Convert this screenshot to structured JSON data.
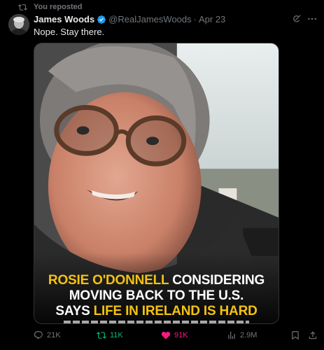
{
  "repost_banner": {
    "text": "You reposted",
    "icon": "repost-icon"
  },
  "author": {
    "display_name": "James Woods",
    "handle": "@RealJamesWoods",
    "separator": "·",
    "date": "Apr 23",
    "verified_icon": "verified-badge-icon",
    "avatar_icon": "avatar"
  },
  "header_actions": {
    "grok_icon": "grok-icon",
    "more_icon": "more-icon"
  },
  "tweet": {
    "text": "Nope. Stay there."
  },
  "media": {
    "headline_line1_highlight": "ROSIE O'DONNELL",
    "headline_line1_rest": " CONSIDERING",
    "headline_line2": "MOVING BACK TO THE U.S.",
    "headline_line3_prefix": "SAYS ",
    "headline_line3_highlight": "LIFE IN IRELAND IS HARD",
    "highlight_color": "#f5c211"
  },
  "actions": {
    "reply_count": "21K",
    "repost_count": "11K",
    "like_count": "91K",
    "views_count": "2.9M",
    "repost_color": "#00ba7c",
    "like_color": "#f91880",
    "muted_color": "#71767b"
  }
}
